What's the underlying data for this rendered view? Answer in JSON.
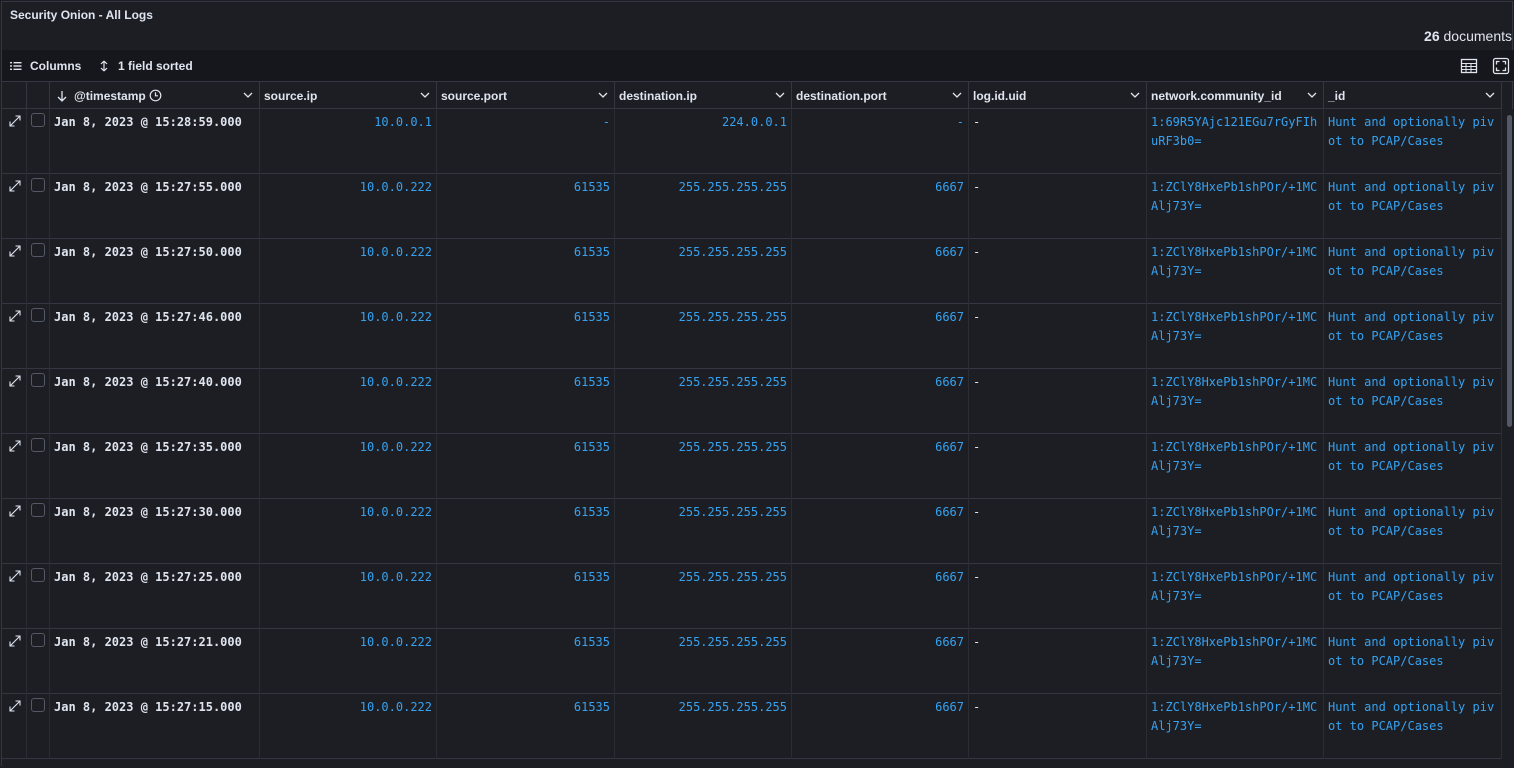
{
  "panel": {
    "title": "Security Onion - All Logs"
  },
  "summary": {
    "count": "26",
    "count_label": "documents"
  },
  "toolbar": {
    "columns_label": "Columns",
    "sort_label": "1 field sorted"
  },
  "columns": [
    {
      "key": "timestamp",
      "label": "@timestamp"
    },
    {
      "key": "source_ip",
      "label": "source.ip"
    },
    {
      "key": "source_port",
      "label": "source.port"
    },
    {
      "key": "destination_ip",
      "label": "destination.ip"
    },
    {
      "key": "destination_port",
      "label": "destination.port"
    },
    {
      "key": "log_id_uid",
      "label": "log.id.uid"
    },
    {
      "key": "community_id",
      "label": "network.community_id"
    },
    {
      "key": "id",
      "label": "_id"
    }
  ],
  "rows": [
    {
      "timestamp": "Jan 8, 2023 @ 15:28:59.000",
      "source_ip": "10.0.0.1",
      "source_port": "-",
      "destination_ip": "224.0.0.1",
      "destination_port": "-",
      "log_id_uid": "-",
      "community_id": "1:69R5YAjc121EGu7rGyFIhuRF3b0=",
      "id": "Hunt and optionally pivot to PCAP/Cases"
    },
    {
      "timestamp": "Jan 8, 2023 @ 15:27:55.000",
      "source_ip": "10.0.0.222",
      "source_port": "61535",
      "destination_ip": "255.255.255.255",
      "destination_port": "6667",
      "log_id_uid": "-",
      "community_id": "1:ZClY8HxePb1shPOr/+1MCAlj73Y=",
      "id": "Hunt and optionally pivot to PCAP/Cases"
    },
    {
      "timestamp": "Jan 8, 2023 @ 15:27:50.000",
      "source_ip": "10.0.0.222",
      "source_port": "61535",
      "destination_ip": "255.255.255.255",
      "destination_port": "6667",
      "log_id_uid": "-",
      "community_id": "1:ZClY8HxePb1shPOr/+1MCAlj73Y=",
      "id": "Hunt and optionally pivot to PCAP/Cases"
    },
    {
      "timestamp": "Jan 8, 2023 @ 15:27:46.000",
      "source_ip": "10.0.0.222",
      "source_port": "61535",
      "destination_ip": "255.255.255.255",
      "destination_port": "6667",
      "log_id_uid": "-",
      "community_id": "1:ZClY8HxePb1shPOr/+1MCAlj73Y=",
      "id": "Hunt and optionally pivot to PCAP/Cases"
    },
    {
      "timestamp": "Jan 8, 2023 @ 15:27:40.000",
      "source_ip": "10.0.0.222",
      "source_port": "61535",
      "destination_ip": "255.255.255.255",
      "destination_port": "6667",
      "log_id_uid": "-",
      "community_id": "1:ZClY8HxePb1shPOr/+1MCAlj73Y=",
      "id": "Hunt and optionally pivot to PCAP/Cases"
    },
    {
      "timestamp": "Jan 8, 2023 @ 15:27:35.000",
      "source_ip": "10.0.0.222",
      "source_port": "61535",
      "destination_ip": "255.255.255.255",
      "destination_port": "6667",
      "log_id_uid": "-",
      "community_id": "1:ZClY8HxePb1shPOr/+1MCAlj73Y=",
      "id": "Hunt and optionally pivot to PCAP/Cases"
    },
    {
      "timestamp": "Jan 8, 2023 @ 15:27:30.000",
      "source_ip": "10.0.0.222",
      "source_port": "61535",
      "destination_ip": "255.255.255.255",
      "destination_port": "6667",
      "log_id_uid": "-",
      "community_id": "1:ZClY8HxePb1shPOr/+1MCAlj73Y=",
      "id": "Hunt and optionally pivot to PCAP/Cases"
    },
    {
      "timestamp": "Jan 8, 2023 @ 15:27:25.000",
      "source_ip": "10.0.0.222",
      "source_port": "61535",
      "destination_ip": "255.255.255.255",
      "destination_port": "6667",
      "log_id_uid": "-",
      "community_id": "1:ZClY8HxePb1shPOr/+1MCAlj73Y=",
      "id": "Hunt and optionally pivot to PCAP/Cases"
    },
    {
      "timestamp": "Jan 8, 2023 @ 15:27:21.000",
      "source_ip": "10.0.0.222",
      "source_port": "61535",
      "destination_ip": "255.255.255.255",
      "destination_port": "6667",
      "log_id_uid": "-",
      "community_id": "1:ZClY8HxePb1shPOr/+1MCAlj73Y=",
      "id": "Hunt and optionally pivot to PCAP/Cases"
    },
    {
      "timestamp": "Jan 8, 2023 @ 15:27:15.000",
      "source_ip": "10.0.0.222",
      "source_port": "61535",
      "destination_ip": "255.255.255.255",
      "destination_port": "6667",
      "log_id_uid": "-",
      "community_id": "1:ZClY8HxePb1shPOr/+1MCAlj73Y=",
      "id": "Hunt and optionally pivot to PCAP/Cases"
    }
  ],
  "icons": {
    "columns": "list-icon",
    "sort": "sort-arrows-icon",
    "density": "table-density-icon",
    "fullscreen": "fullscreen-icon",
    "expand": "expand-row-icon",
    "sort_desc": "arrow-down-icon",
    "clock": "clock-icon",
    "chevron": "chevron-down-icon"
  },
  "colors": {
    "background": "#1d1e24",
    "link": "#36a2ef",
    "text": "#dfe5ef",
    "border": "#343741"
  }
}
